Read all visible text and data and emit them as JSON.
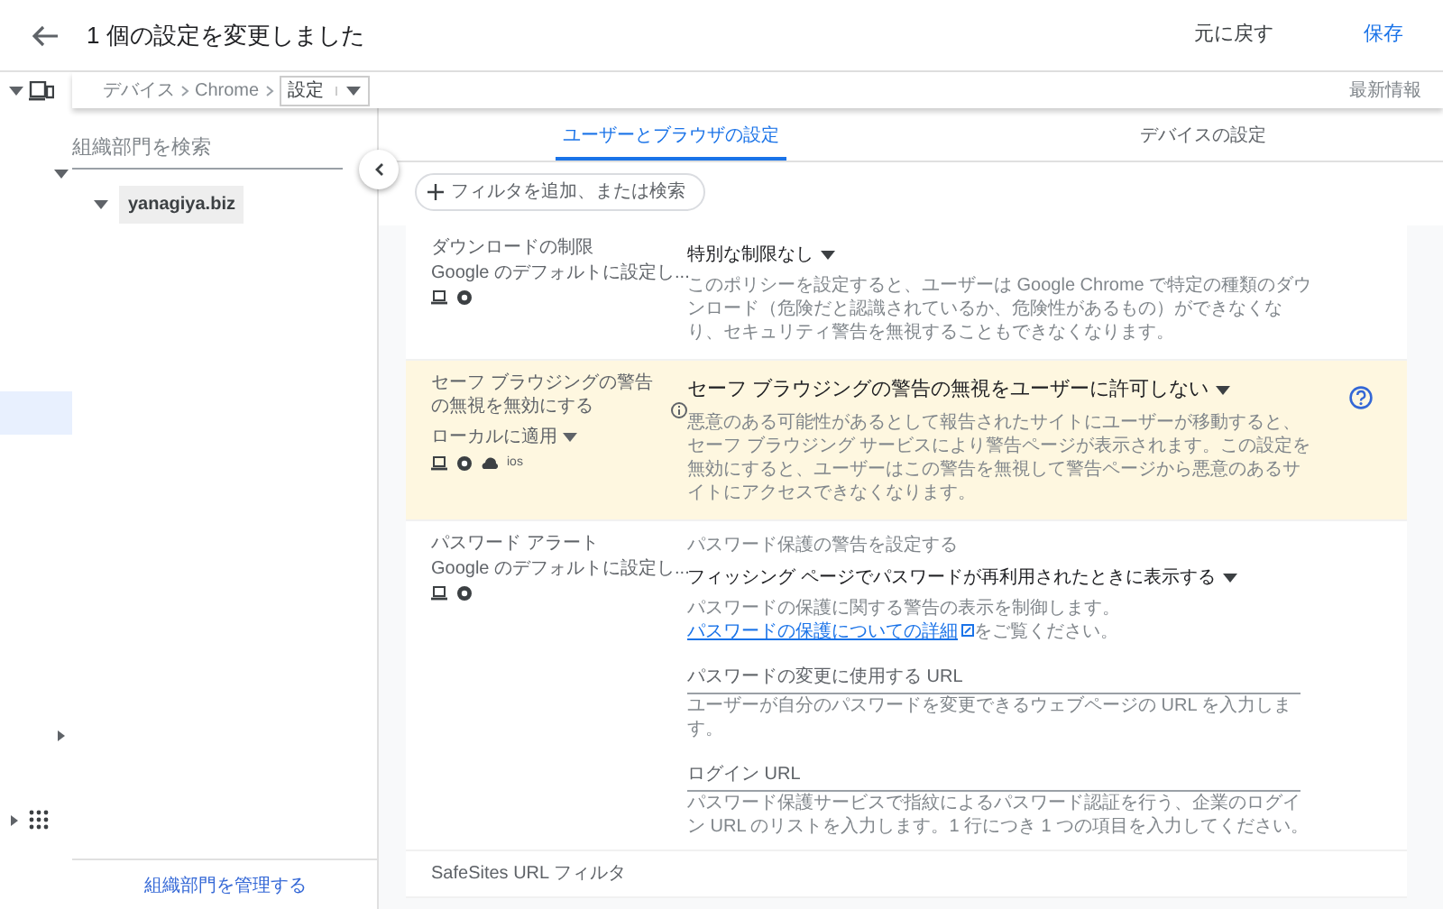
{
  "header": {
    "title": "1 個の設定を変更しました",
    "actions": [
      {
        "label": "元に戻す",
        "kind": "plain"
      },
      {
        "label": "保存",
        "kind": "primary"
      }
    ]
  },
  "breadcrumb": {
    "items": [
      "デバイス",
      "Chrome"
    ],
    "current": "設定",
    "whats_new": "最新情報"
  },
  "org_panel": {
    "search_placeholder": "組織部門を検索",
    "tree": [
      {
        "label": "yanagiya.biz",
        "selected": true,
        "expanded": true
      }
    ],
    "manage_link": "組織部門を管理する"
  },
  "tabs": [
    {
      "label": "ユーザーとブラウザの設定",
      "selected": true
    },
    {
      "label": "デバイスの設定",
      "selected": false
    }
  ],
  "filter": {
    "placeholder": "フィルタを追加、または検索"
  },
  "settings": [
    {
      "name": "ダウンロードの制限",
      "status": "Google のデフォルトに設定し...",
      "platforms": [
        {
          "kind": "laptop"
        },
        {
          "kind": "chrome"
        }
      ],
      "highlighted": false,
      "items": [
        {
          "kind": "select",
          "value": "特別な制限なし"
        },
        {
          "kind": "description",
          "text": "このポリシーを設定すると、ユーザーは Google Chrome で特定の種類のダウンロード（危険だと認識されているか、危険性があるもの）ができなくなり、セキュリティ警告を無視することもできなくなります。"
        }
      ]
    },
    {
      "name": "セーフ ブラウジングの警告の無視を無効にする",
      "info": true,
      "status": "ローカルに適用",
      "status_menu": true,
      "platforms": [
        {
          "kind": "laptop"
        },
        {
          "kind": "chrome"
        },
        {
          "kind": "cloud"
        },
        {
          "kind": "label",
          "text": "ios"
        }
      ],
      "highlighted": true,
      "help": true,
      "items": [
        {
          "kind": "select",
          "value": "セーフ ブラウジングの警告の無視をユーザーに許可しない"
        },
        {
          "kind": "description",
          "text": "悪意のある可能性があるとして報告されたサイトにユーザーが移動すると、セーフ ブラウジング サービスにより警告ページが表示されます。この設定を無効にすると、ユーザーはこの警告を無視して警告ページから悪意のあるサイトにアクセスできなくなります。"
        }
      ]
    },
    {
      "name": "パスワード アラート",
      "status": "Google のデフォルトに設定し...",
      "platforms": [
        {
          "kind": "laptop"
        },
        {
          "kind": "chrome"
        }
      ],
      "highlighted": false,
      "items": [
        {
          "kind": "label",
          "text": "パスワード保護の警告を設定する"
        },
        {
          "kind": "select",
          "value": "フィッシング ページでパスワードが再利用されたときに表示する"
        },
        {
          "kind": "description",
          "text": "パスワードの保護に関する警告の表示を制御します。",
          "link": "パスワードの保護についての詳細",
          "text_after": "をご覧ください。"
        },
        {
          "kind": "input",
          "placeholder": "パスワードの変更に使用する URL"
        },
        {
          "kind": "hint",
          "text": "ユーザーが自分のパスワードを変更できるウェブページの URL を入力します。"
        },
        {
          "kind": "input",
          "placeholder": "ログイン URL"
        },
        {
          "kind": "hint",
          "text": "パスワード保護サービスで指紋によるパスワード認証を行う、企業のログイン URL のリストを入力します。1 行につき 1 つの項目を入力してください。"
        }
      ]
    },
    {
      "name": "SafeSites URL フィルタ",
      "highlighted": false
    }
  ]
}
